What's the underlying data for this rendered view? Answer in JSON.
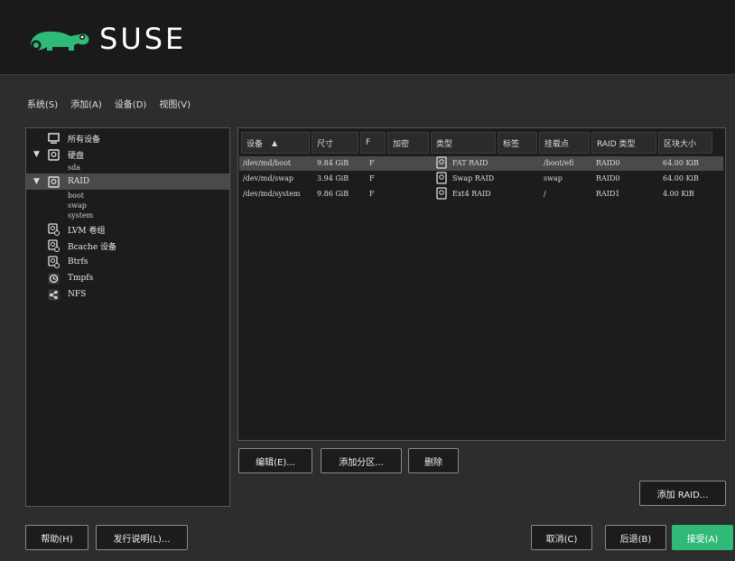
{
  "brand": {
    "name": "SUSE",
    "color": "#30ba78"
  },
  "menu": [
    "系统(S)",
    "添加(A)",
    "设备(D)",
    "视图(V)"
  ],
  "tree": {
    "items": [
      {
        "label": "所有设备",
        "icon": "monitor-icon"
      },
      {
        "label": "硬盘",
        "icon": "disk-icon",
        "children": [
          "sda"
        ]
      },
      {
        "label": "RAID",
        "icon": "raid-icon",
        "children": [
          "boot",
          "swap",
          "system"
        ]
      },
      {
        "label": "LVM 卷组",
        "icon": "lvm-icon"
      },
      {
        "label": "Bcache 设备",
        "icon": "bcache-icon"
      },
      {
        "label": "Btrfs",
        "icon": "btrfs-icon"
      },
      {
        "label": "Tmpfs",
        "icon": "tmpfs-icon"
      },
      {
        "label": "NFS",
        "icon": "nfs-icon"
      }
    ]
  },
  "table": {
    "columns": [
      "设备",
      "尺寸",
      "F",
      "加密",
      "类型",
      "标签",
      "挂载点",
      "RAID 类型",
      "区块大小"
    ],
    "rows": [
      {
        "device": "/dev/md/boot",
        "size": "9.84 GiB",
        "f": "F",
        "type": "FAT RAID",
        "label": "",
        "mount": "/boot/efi",
        "raid": "RAID0",
        "chunk": "64.00 KiB"
      },
      {
        "device": "/dev/md/swap",
        "size": "3.94 GiB",
        "f": "F",
        "type": "Swap RAID",
        "label": "",
        "mount": "swap",
        "raid": "RAID0",
        "chunk": "64.00 KiB"
      },
      {
        "device": "/dev/md/system",
        "size": "9.86 GiB",
        "f": "F",
        "type": "Ext4 RAID",
        "label": "",
        "mount": "/",
        "raid": "RAID1",
        "chunk": "4.00 KiB"
      }
    ]
  },
  "actions": {
    "edit": "编辑(E)...",
    "add_partition": "添加分区...",
    "delete": "删除",
    "add_raid": "添加 RAID..."
  },
  "footer": {
    "help": "帮助(H)",
    "release_notes": "发行说明(L)...",
    "cancel": "取消(C)",
    "back": "后退(B)",
    "accept": "接受(A)"
  }
}
